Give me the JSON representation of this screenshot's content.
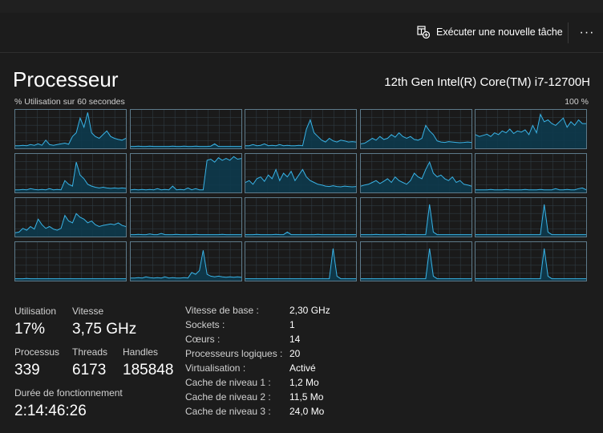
{
  "toolbar": {
    "run_task_label": "Exécuter une nouvelle tâche",
    "more_label": "···"
  },
  "header": {
    "title": "Processeur",
    "cpu_name": "12th Gen Intel(R) Core(TM) i7-12700H"
  },
  "graph": {
    "label_left": "% Utilisation sur 60 secondes",
    "label_right": "100 %",
    "line_color": "#39b3e6",
    "fill_color": "#0d3a4d",
    "grid_color": "#2f3b42",
    "series": [
      [
        5,
        5,
        6,
        5,
        8,
        6,
        10,
        6,
        20,
        8,
        6,
        8,
        10,
        12,
        9,
        30,
        40,
        80,
        55,
        95,
        40,
        30,
        25,
        35,
        45,
        30,
        25,
        22,
        20,
        25
      ],
      [
        3,
        3,
        4,
        3,
        3,
        4,
        3,
        3,
        3,
        3,
        3,
        4,
        3,
        3,
        4,
        3,
        3,
        4,
        3,
        3,
        3,
        4,
        10,
        3,
        3,
        3,
        3,
        3,
        3,
        3
      ],
      [
        5,
        5,
        8,
        5,
        6,
        10,
        5,
        6,
        5,
        8,
        5,
        6,
        5,
        5,
        6,
        5,
        50,
        75,
        40,
        30,
        20,
        15,
        25,
        18,
        15,
        20,
        18,
        15,
        16,
        15
      ],
      [
        10,
        12,
        18,
        25,
        20,
        30,
        22,
        25,
        35,
        28,
        40,
        30,
        25,
        30,
        22,
        20,
        25,
        60,
        45,
        35,
        18,
        15,
        14,
        16,
        15,
        14,
        13,
        14,
        15,
        14
      ],
      [
        35,
        30,
        33,
        36,
        30,
        40,
        35,
        45,
        40,
        50,
        38,
        45,
        42,
        48,
        35,
        60,
        40,
        90,
        70,
        75,
        65,
        60,
        70,
        80,
        55,
        70,
        60,
        75,
        65,
        65
      ],
      [
        5,
        5,
        6,
        5,
        8,
        6,
        5,
        6,
        5,
        8,
        5,
        6,
        5,
        30,
        20,
        15,
        80,
        45,
        35,
        20,
        15,
        12,
        10,
        12,
        10,
        9,
        10,
        9,
        10,
        9
      ],
      [
        5,
        6,
        5,
        6,
        5,
        6,
        5,
        8,
        5,
        6,
        5,
        15,
        5,
        6,
        5,
        10,
        5,
        8,
        5,
        5,
        85,
        88,
        80,
        92,
        85,
        90,
        85,
        95,
        88,
        90
      ],
      [
        25,
        30,
        20,
        35,
        40,
        28,
        45,
        35,
        60,
        30,
        50,
        40,
        55,
        30,
        45,
        60,
        40,
        30,
        25,
        20,
        18,
        15,
        14,
        16,
        14,
        13,
        15,
        14,
        13,
        14
      ],
      [
        15,
        18,
        20,
        25,
        30,
        22,
        28,
        35,
        25,
        40,
        30,
        25,
        20,
        30,
        50,
        40,
        35,
        60,
        80,
        50,
        40,
        45,
        35,
        30,
        40,
        25,
        30,
        20,
        18,
        15
      ],
      [
        5,
        5,
        5,
        5,
        6,
        5,
        5,
        5,
        6,
        5,
        5,
        5,
        5,
        6,
        5,
        5,
        5,
        6,
        5,
        5,
        5,
        8,
        5,
        5,
        6,
        5,
        5,
        8,
        10,
        5
      ],
      [
        8,
        10,
        20,
        15,
        25,
        18,
        45,
        30,
        20,
        25,
        18,
        15,
        20,
        55,
        40,
        35,
        60,
        50,
        45,
        35,
        40,
        30,
        25,
        28,
        30,
        32,
        30,
        35,
        28,
        25
      ],
      [
        3,
        3,
        4,
        3,
        3,
        5,
        3,
        3,
        6,
        3,
        3,
        3,
        4,
        3,
        3,
        3,
        3,
        4,
        3,
        3,
        3,
        3,
        3,
        3,
        4,
        3,
        3,
        3,
        3,
        3
      ],
      [
        3,
        3,
        3,
        4,
        3,
        3,
        3,
        3,
        4,
        3,
        3,
        10,
        3,
        3,
        3,
        3,
        3,
        3,
        3,
        4,
        3,
        3,
        3,
        3,
        3,
        3,
        3,
        3,
        3,
        3
      ],
      [
        3,
        3,
        3,
        3,
        4,
        3,
        3,
        3,
        3,
        3,
        3,
        4,
        3,
        3,
        3,
        3,
        3,
        3,
        85,
        10,
        3,
        3,
        3,
        3,
        3,
        3,
        3,
        3,
        3,
        3
      ],
      [
        3,
        3,
        3,
        3,
        3,
        3,
        3,
        3,
        3,
        3,
        3,
        3,
        3,
        3,
        3,
        3,
        3,
        3,
        85,
        10,
        3,
        3,
        3,
        3,
        3,
        3,
        3,
        3,
        3,
        3
      ],
      [
        3,
        3,
        3,
        4,
        3,
        3,
        3,
        3,
        3,
        3,
        3,
        3,
        3,
        3,
        3,
        3,
        3,
        3,
        3,
        3,
        3,
        3,
        3,
        3,
        3,
        3,
        3,
        3,
        3,
        3
      ],
      [
        5,
        5,
        6,
        5,
        8,
        6,
        5,
        6,
        5,
        8,
        5,
        6,
        5,
        5,
        6,
        5,
        20,
        15,
        25,
        80,
        15,
        10,
        8,
        10,
        8,
        7,
        8,
        7,
        8,
        7
      ],
      [
        3,
        3,
        3,
        3,
        3,
        3,
        3,
        3,
        3,
        3,
        3,
        3,
        3,
        3,
        3,
        3,
        3,
        3,
        3,
        3,
        3,
        3,
        3,
        85,
        10,
        3,
        3,
        3,
        3,
        3
      ],
      [
        3,
        3,
        3,
        3,
        3,
        3,
        3,
        3,
        3,
        3,
        3,
        3,
        3,
        3,
        3,
        3,
        3,
        3,
        85,
        10,
        3,
        3,
        3,
        3,
        3,
        3,
        3,
        3,
        3,
        3
      ],
      [
        3,
        3,
        3,
        3,
        3,
        3,
        3,
        3,
        3,
        3,
        3,
        3,
        3,
        3,
        3,
        3,
        3,
        3,
        85,
        10,
        3,
        3,
        3,
        3,
        3,
        3,
        3,
        3,
        3,
        3
      ]
    ]
  },
  "stats": {
    "utilisation": {
      "label": "Utilisation",
      "value": "17%"
    },
    "vitesse": {
      "label": "Vitesse",
      "value": "3,75 GHz"
    },
    "processus": {
      "label": "Processus",
      "value": "339"
    },
    "threads": {
      "label": "Threads",
      "value": "6173"
    },
    "handles": {
      "label": "Handles",
      "value": "185848"
    },
    "uptime": {
      "label": "Durée de fonctionnement",
      "value": "2:14:46:26"
    }
  },
  "info": [
    {
      "key": "Vitesse de base :",
      "value": "2,30 GHz"
    },
    {
      "key": "Sockets :",
      "value": "1"
    },
    {
      "key": "Cœurs :",
      "value": "14"
    },
    {
      "key": "Processeurs logiques :",
      "value": "20"
    },
    {
      "key": "Virtualisation :",
      "value": "Activé"
    },
    {
      "key": "Cache de niveau 1 :",
      "value": "1,2 Mo"
    },
    {
      "key": "Cache de niveau 2 :",
      "value": "11,5 Mo"
    },
    {
      "key": "Cache de niveau 3 :",
      "value": "24,0 Mo"
    }
  ]
}
